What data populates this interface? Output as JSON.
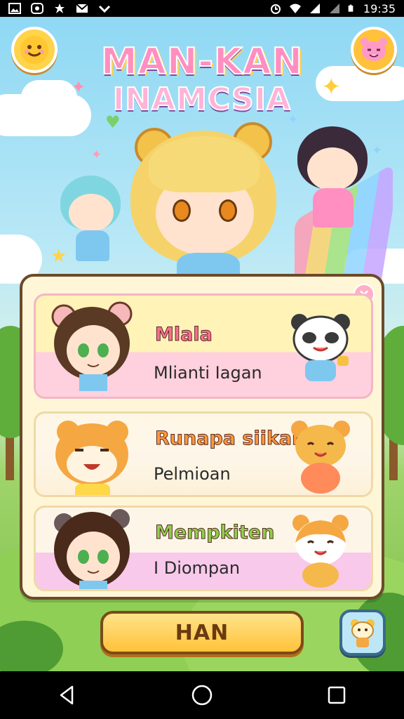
{
  "status_bar": {
    "time": "19:35",
    "icons": [
      "image-icon",
      "messenger-icon",
      "star-icon",
      "mail-icon",
      "chevron-icon",
      "alarm-icon",
      "wifi-icon",
      "signal-icon",
      "signal-icon",
      "battery-icon"
    ]
  },
  "game": {
    "title_line1": "MAN-KAN",
    "title_line2": "INAMCSIA",
    "close_symbol": "×",
    "cards": [
      {
        "title": "Mlala",
        "subtitle": "Mlianti Iagan",
        "title_color": "#ff6f8e"
      },
      {
        "title": "Runapa siikan",
        "subtitle": "Pelmioan",
        "title_color": "#ff9a3a"
      },
      {
        "title": "Mempkiten",
        "subtitle": "I Diompan",
        "title_color": "#8ed14a"
      }
    ],
    "primary_button": "HAN"
  },
  "colors": {
    "panel_border": "#6b4a2a",
    "button_yellow": "#ffc23a",
    "sky": "#8fd8f4",
    "grass": "#7fbf4e"
  },
  "nav_bar": {
    "icons": [
      "back-icon",
      "home-icon",
      "recents-icon"
    ]
  }
}
